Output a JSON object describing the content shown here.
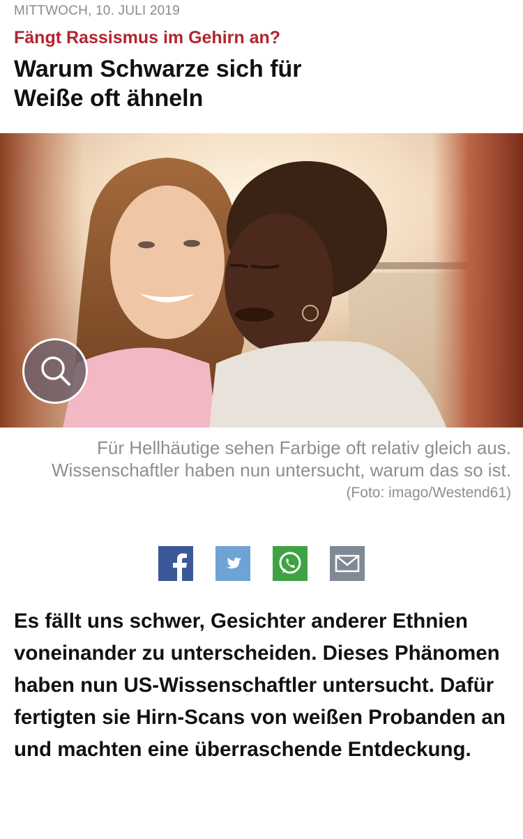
{
  "article": {
    "date": "MITTWOCH, 10. JULI 2019",
    "kicker": "Fängt Rassismus im Gehirn an?",
    "headline_line1": "Warum Schwarze sich für",
    "headline_line2": "Weiße oft ähneln",
    "caption_line1": "Für Hellhäutige sehen Farbige oft relativ gleich aus.",
    "caption_line2": "Wissenschaftler haben nun untersucht, warum das so ist.",
    "photo_credit": "(Foto: imago/Westend61)",
    "lead": "Es fällt uns schwer, Gesichter anderer Ethnien voneinander zu unterscheiden. Dieses Phänomen haben nun US-Wissenschaftler untersucht. Dafür fertigten sie Hirn-Scans von weißen Probanden an und machten eine überraschende Entdeckung."
  },
  "hero_image": {
    "zoom_icon": "magnifier-icon"
  },
  "share": [
    {
      "network": "facebook",
      "icon": "facebook-icon",
      "color": "#3b5998"
    },
    {
      "network": "twitter",
      "icon": "twitter-icon",
      "color": "#6ea3d6"
    },
    {
      "network": "whatsapp",
      "icon": "whatsapp-icon",
      "color": "#3fa244"
    },
    {
      "network": "email",
      "icon": "mail-icon",
      "color": "#7e8a95"
    }
  ],
  "colors": {
    "kicker": "#b3242e",
    "date": "#8a8a8a",
    "caption": "#8e8e8e"
  }
}
